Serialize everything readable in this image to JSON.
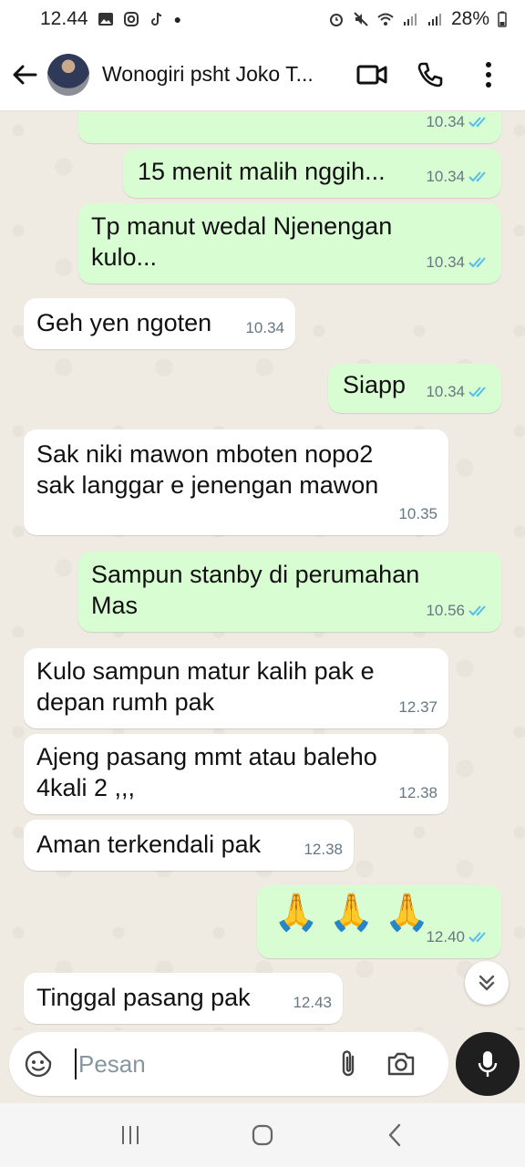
{
  "status_bar": {
    "time": "12.44",
    "battery": "28%"
  },
  "header": {
    "contact_name": "Wonogiri psht Joko T..."
  },
  "messages": [
    {
      "dir": "out",
      "text": "",
      "time": "10.34"
    },
    {
      "dir": "out",
      "text": "15 menit malih nggih...",
      "time": "10.34"
    },
    {
      "dir": "out",
      "line1": "Tp manut wedal Njenengan",
      "line2": "kulo...",
      "time": "10.34"
    },
    {
      "dir": "in",
      "text": "Geh yen ngoten",
      "time": "10.34"
    },
    {
      "dir": "out",
      "text": "Siapp",
      "time": "10.34"
    },
    {
      "dir": "in",
      "line1": "Sak niki mawon mboten nopo2",
      "line2": "sak langgar e jenengan mawon",
      "time": "10.35"
    },
    {
      "dir": "out",
      "line1": "Sampun stanby di perumahan",
      "line2": "Mas",
      "time": "10.56"
    },
    {
      "dir": "in",
      "line1": "Kulo sampun matur kalih pak e",
      "line2": "depan rumh pak",
      "time": "12.37"
    },
    {
      "dir": "in",
      "line1": "Ajeng pasang mmt atau baleho",
      "line2": "4kali 2 ,,,",
      "time": "12.38"
    },
    {
      "dir": "in",
      "text": "Aman terkendali pak",
      "time": "12.38"
    },
    {
      "dir": "out",
      "text": "🙏 🙏 🙏",
      "time": "12.40"
    },
    {
      "dir": "in",
      "text": "Tinggal pasang pak",
      "time": "12.43"
    }
  ],
  "composer": {
    "placeholder": "Pesan"
  },
  "colors": {
    "outgoing_bubble": "#d9fdd3",
    "incoming_bubble": "#ffffff",
    "read_tick": "#53bdeb",
    "mic_button": "#1f1f1f"
  }
}
